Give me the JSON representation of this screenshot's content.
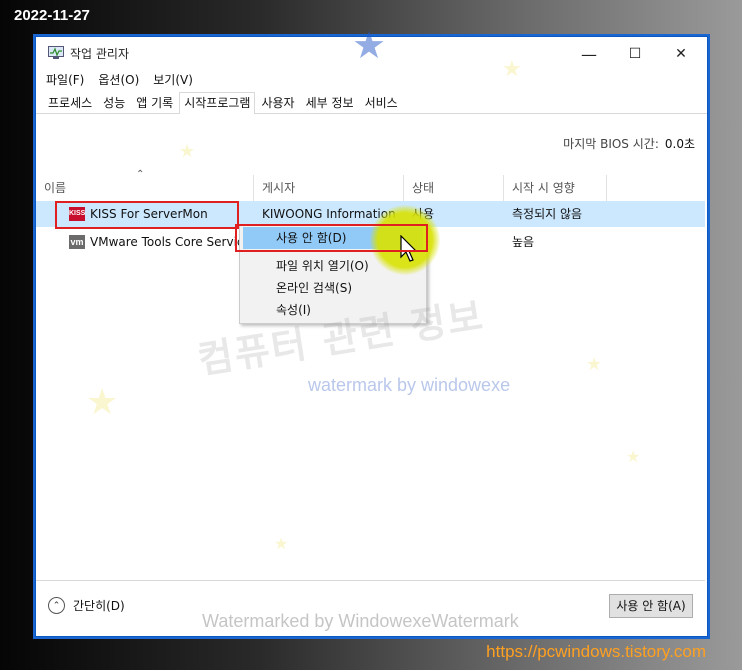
{
  "overlay": {
    "date": "2022-11-27",
    "site": "https://pcwindows.tistory.com",
    "watermark_ko": "컴퓨터 관련 정보",
    "watermark_en": "watermark by windowexe",
    "watermark_bottom": "Watermarked by WindowexeWatermark"
  },
  "window": {
    "title": "작업 관리자",
    "minimize": "—",
    "maximize": "☐",
    "close": "✕"
  },
  "menu": [
    "파일(F)",
    "옵션(O)",
    "보기(V)"
  ],
  "tabs": [
    "프로세스",
    "성능",
    "앱 기록",
    "시작프로그램",
    "사용자",
    "세부 정보",
    "서비스"
  ],
  "active_tab": "시작프로그램",
  "bios": {
    "label": "마지막 BIOS 시간:",
    "value": "0.0초"
  },
  "columns": [
    "이름",
    "게시자",
    "상태",
    "시작 시 영향"
  ],
  "rows": [
    {
      "name": "KISS For ServerMon",
      "icon": "kiss-icon",
      "icon_text": "KISS",
      "publisher": "KIWOONG Information",
      "status": "사용",
      "impact": "측정되지 않음"
    },
    {
      "name": "VMware Tools Core Service",
      "icon": "vmware-icon",
      "icon_text": "vm",
      "publisher": "",
      "status": "용",
      "impact": "높음"
    }
  ],
  "context_menu": [
    "사용 안 함(D)",
    "파일 위치 열기(O)",
    "온라인 검색(S)",
    "속성(I)"
  ],
  "footer": {
    "fewer_details": "간단히(D)",
    "disable_button": "사용 안 함(A)"
  },
  "colors": {
    "selection": "#cce8ff",
    "menu_highlight": "#91c9f7",
    "red_box": "#e02020",
    "window_border": "#1a66d0",
    "site_text": "#ffa020"
  }
}
